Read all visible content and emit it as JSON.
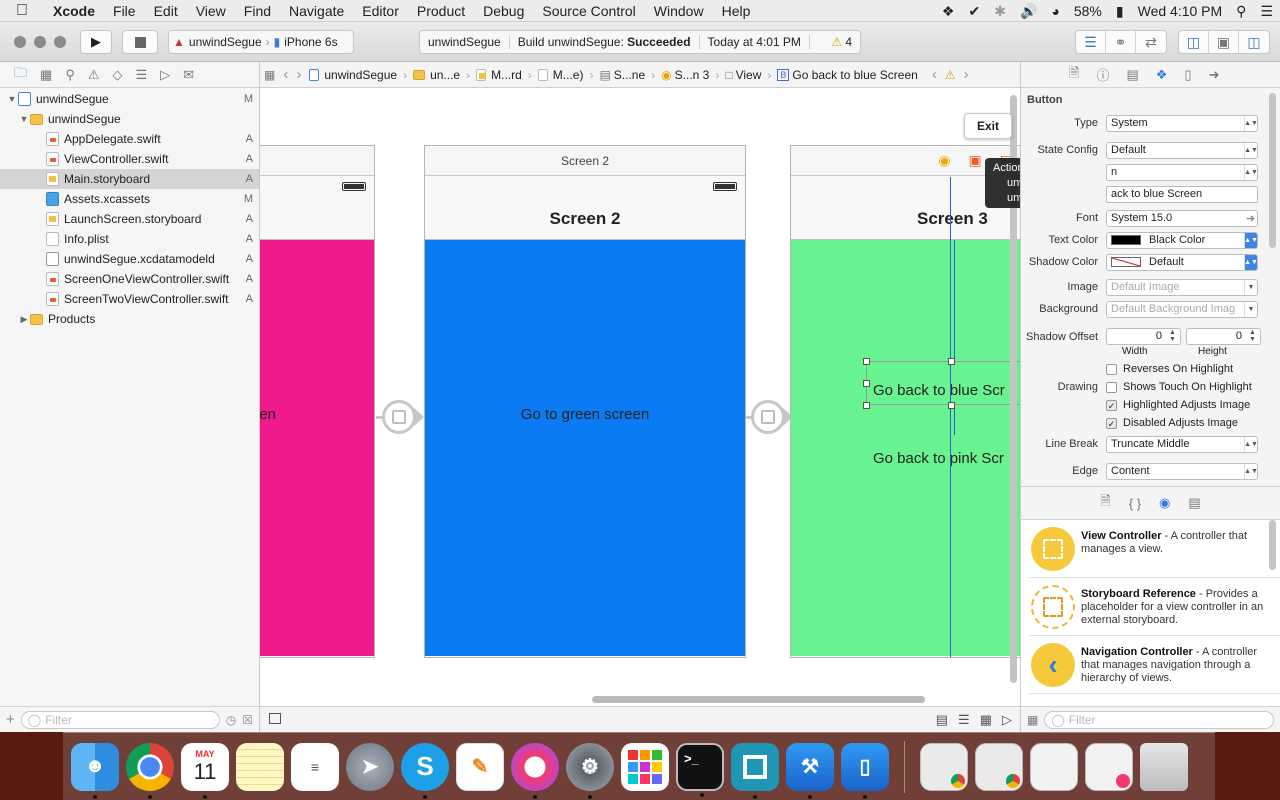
{
  "menubar": {
    "app": "Xcode",
    "items": [
      "File",
      "Edit",
      "View",
      "Find",
      "Navigate",
      "Editor",
      "Product",
      "Debug",
      "Source Control",
      "Window",
      "Help"
    ],
    "battery": "58%",
    "clock": "Wed 4:10 PM"
  },
  "toolbar": {
    "scheme": "unwindSegue",
    "device": "iPhone 6s",
    "activity_project": "unwindSegue",
    "build_prefix": "Build unwindSegue: ",
    "build_status": "Succeeded",
    "build_time": "Today at 4:01 PM",
    "warnings": "4"
  },
  "navigator": {
    "items": [
      {
        "label": "unwindSegue",
        "badge": "M"
      },
      {
        "label": "unwindSegue",
        "badge": ""
      },
      {
        "label": "AppDelegate.swift",
        "badge": "A"
      },
      {
        "label": "ViewController.swift",
        "badge": "A"
      },
      {
        "label": "Main.storyboard",
        "badge": "A"
      },
      {
        "label": "Assets.xcassets",
        "badge": "M"
      },
      {
        "label": "LaunchScreen.storyboard",
        "badge": "A"
      },
      {
        "label": "Info.plist",
        "badge": "A"
      },
      {
        "label": "unwindSegue.xcdatamodeld",
        "badge": "A"
      },
      {
        "label": "ScreenOneViewController.swift",
        "badge": "A"
      },
      {
        "label": "ScreenTwoViewController.swift",
        "badge": "A"
      },
      {
        "label": "Products",
        "badge": ""
      }
    ],
    "filter_placeholder": "Filter"
  },
  "jumpbar": {
    "crumbs": [
      "unwindSegue",
      "un...e",
      "M...rd",
      "M...e)",
      "S...ne",
      "S...n 3",
      "View",
      "Go back to blue Screen"
    ]
  },
  "canvas": {
    "screen1": {
      "button_fragment": "en",
      "color": "#ef1a8c"
    },
    "screen2": {
      "title": "Screen 2",
      "nav_title": "Screen 2",
      "button": "Go to green screen",
      "color": "#0a7bf2"
    },
    "screen3": {
      "nav_title": "Screen 3",
      "button_blue": "Go back to blue Scr",
      "button_pink": "Go back to pink Scr",
      "color": "#66f390"
    },
    "exit_label": "Exit",
    "tooltip": {
      "title": "Action Segue",
      "line1": "unwindToScreenOne:",
      "line2": "unwindToScreenTwo:"
    }
  },
  "inspector": {
    "section": "Button",
    "type": {
      "label": "Type",
      "value": "System"
    },
    "state_config": {
      "label": "State Config",
      "value": "Default"
    },
    "title_row_value": "n",
    "title_text": "ack to blue Screen",
    "font": {
      "label": "Font",
      "value": "System 15.0"
    },
    "text_color": {
      "label": "Text Color",
      "value": "Black Color"
    },
    "shadow_color": {
      "label": "Shadow Color",
      "value": "Default"
    },
    "image": {
      "label": "Image",
      "placeholder": "Default Image"
    },
    "background": {
      "label": "Background",
      "placeholder": "Default Background Imag"
    },
    "shadow_offset": {
      "label": "Shadow Offset",
      "width": "0",
      "height": "0",
      "width_label": "Width",
      "height_label": "Height"
    },
    "drawing_label": "Drawing",
    "checks": [
      {
        "label": "Reverses On Highlight",
        "checked": false
      },
      {
        "label": "Shows Touch On Highlight",
        "checked": false
      },
      {
        "label": "Highlighted Adjusts Image",
        "checked": true
      },
      {
        "label": "Disabled Adjusts Image",
        "checked": true
      }
    ],
    "line_break": {
      "label": "Line Break",
      "value": "Truncate Middle"
    },
    "edge": {
      "label": "Edge",
      "value": "Content"
    }
  },
  "library": {
    "items": [
      {
        "name": "View Controller",
        "desc": " - A controller that manages a view."
      },
      {
        "name": "Storyboard Reference",
        "desc": " - Provides a placeholder for a view controller in an external storyboard."
      },
      {
        "name": "Navigation Controller",
        "desc": " - A controller that manages navigation through a hierarchy of views."
      }
    ],
    "filter_placeholder": "Filter"
  },
  "dock": {
    "calendar_month": "MAY",
    "calendar_day": "11"
  }
}
